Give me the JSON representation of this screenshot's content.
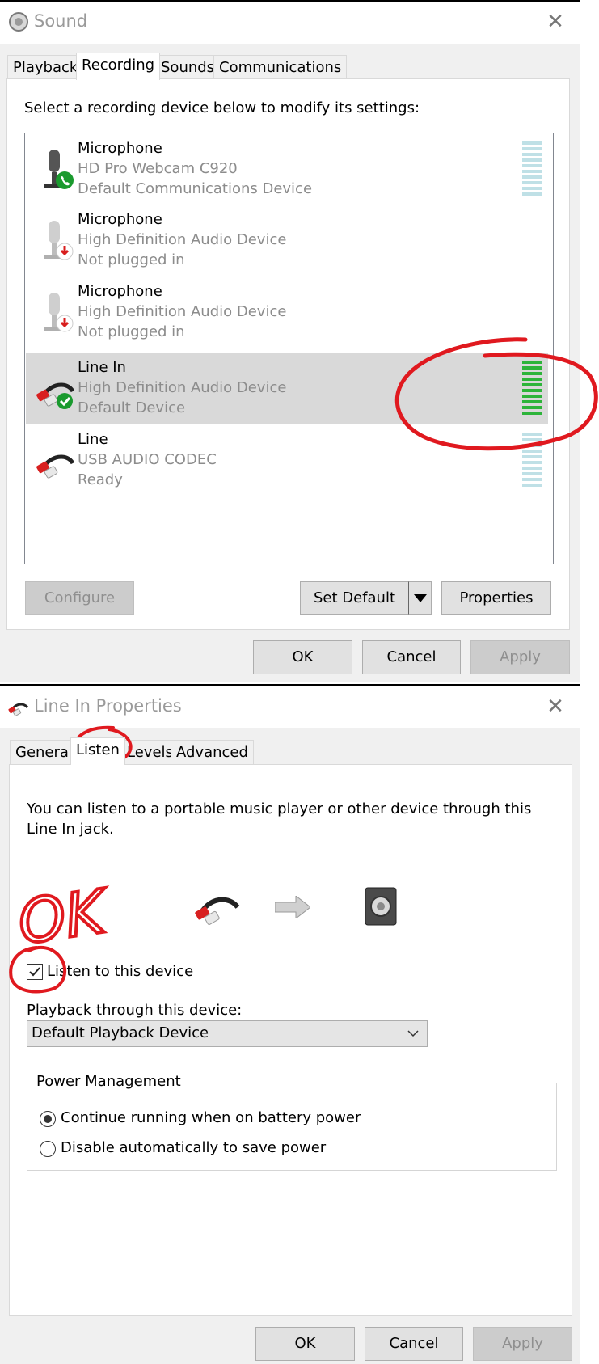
{
  "sound_window": {
    "title": "Sound",
    "tabs": [
      {
        "label": "Playback"
      },
      {
        "label": "Recording"
      },
      {
        "label": "Sounds"
      },
      {
        "label": "Communications"
      }
    ],
    "instruction": "Select a recording device below to modify its settings:",
    "devices": [
      {
        "name": "Microphone",
        "description": "HD Pro Webcam C920",
        "status": "Default Communications Device",
        "icon": "microphone-icon",
        "badge": "phone-badge-icon",
        "level": 0,
        "selected": false
      },
      {
        "name": "Microphone",
        "description": "High Definition Audio Device",
        "status": "Not plugged in",
        "icon": "microphone-icon",
        "badge": "unplugged-badge-icon",
        "level": null,
        "selected": false
      },
      {
        "name": "Microphone",
        "description": "High Definition Audio Device",
        "status": "Not plugged in",
        "icon": "microphone-icon",
        "badge": "unplugged-badge-icon",
        "level": null,
        "selected": false
      },
      {
        "name": "Line In",
        "description": "High Definition Audio Device",
        "status": "Default Device",
        "icon": "rca-cable-icon",
        "badge": "check-badge-icon",
        "level": 1.0,
        "selected": true
      },
      {
        "name": "Line",
        "description": "USB AUDIO  CODEC",
        "status": "Ready",
        "icon": "rca-cable-icon",
        "badge": "",
        "level": 0,
        "selected": false
      }
    ],
    "buttons": {
      "configure": "Configure",
      "set_default": "Set Default",
      "properties": "Properties",
      "ok": "OK",
      "cancel": "Cancel",
      "apply": "Apply"
    }
  },
  "properties_window": {
    "title": "Line In Properties",
    "tabs": [
      {
        "label": "General"
      },
      {
        "label": "Listen"
      },
      {
        "label": "Levels"
      },
      {
        "label": "Advanced"
      }
    ],
    "description": "You can listen to a portable music player or other device through this Line In jack.",
    "listen_checkbox": {
      "label": "Listen to this device",
      "checked": true
    },
    "playback_label": "Playback through this device:",
    "playback_select": "Default Playback Device",
    "power_group": {
      "title": "Power Management",
      "options": [
        {
          "label": "Continue running when on battery power",
          "selected": true
        },
        {
          "label": "Disable automatically to save power",
          "selected": false
        }
      ]
    },
    "buttons": {
      "ok": "OK",
      "cancel": "Cancel",
      "apply": "Apply"
    }
  },
  "annotations": {
    "handwritten_text": "OK",
    "ink_color": "#e0191f"
  },
  "colors": {
    "meter_active": "#2db43a",
    "meter_idle": "#bfe0e6",
    "selection": "#d9d9d9"
  }
}
